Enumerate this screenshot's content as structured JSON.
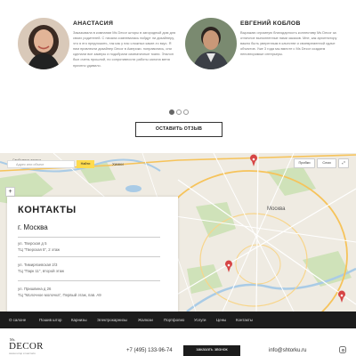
{
  "reviews": {
    "items": [
      {
        "name": "АНАСТАСИЯ",
        "text": "Заказывала в компании Ms Decor шторы в загородный дом для своих родителей. С начала сомневалась пойдут ли дизайнеру, что я его предложить, так как у нас сложных какие-то вкус. Я ним привлекли дизайнер Decor в Америки. понравились, они сделали все замеры и подобрали симпатичные ткани. Эталон был очень прошлой, по сопротивности работы салона меня приятно удивило."
      },
      {
        "name": "ЕВГЕНИЙ КОБЛОВ",
        "text": "Выражаю огромную благодарность коллективу Ms Decor за отличное выполненные нами заказов. Мне, как архитектору важно быть уверенным в качестве и своевременной сдаче объектов. Уже 3 года мы вместе с Ms Decor создаем неповторимые интерьеры."
      }
    ],
    "pagination": {
      "count": 3,
      "active": 0
    },
    "button_label": "ОСТАВИТЬ ОТЗЫВ"
  },
  "map": {
    "search_label": "Свободные адреса",
    "search_placeholder": "Адрес или объект",
    "search_button": "Найти",
    "route_button": "Пробки",
    "layers_button": "Слои",
    "zoom_in": "+",
    "labels": [
      "Химки",
      "Москва"
    ]
  },
  "contacts": {
    "title": "КОНТАКТЫ",
    "city": "г. Москва",
    "addresses": [
      {
        "line1": "ул. Тверская д 5",
        "line2": "ТЦ \"Тверская 5\", 2 этаж"
      },
      {
        "line1": "ул. Тимирязевская 2/3",
        "line2": "ТЦ \"Парк 11\", второй этаж"
      },
      {
        "line1": "ул. Пришвина д 26",
        "line2": "ТЦ \"Молочное молочка\", Первый этаж, пав. А9"
      }
    ]
  },
  "nav": {
    "items": [
      "О салоне",
      "Пошив штор",
      "Карнизы",
      "Электрокарнизы",
      "Жалюзи",
      "Портфолио",
      "Услуги",
      "Цены",
      "Контакты"
    ]
  },
  "footer": {
    "logo_small": "Ms.",
    "logo_big": "DECOR",
    "logo_tag": "салон штор и текстиля",
    "phone": "+7 (495) 133-96-74",
    "call_button": "заказать звонок",
    "email": "info@shtorku.ru"
  },
  "colors": {
    "dark": "#1c1c1c",
    "map_bg": "#efebe2",
    "search_yellow": "#ffdb4d",
    "pin": "#d64545"
  }
}
